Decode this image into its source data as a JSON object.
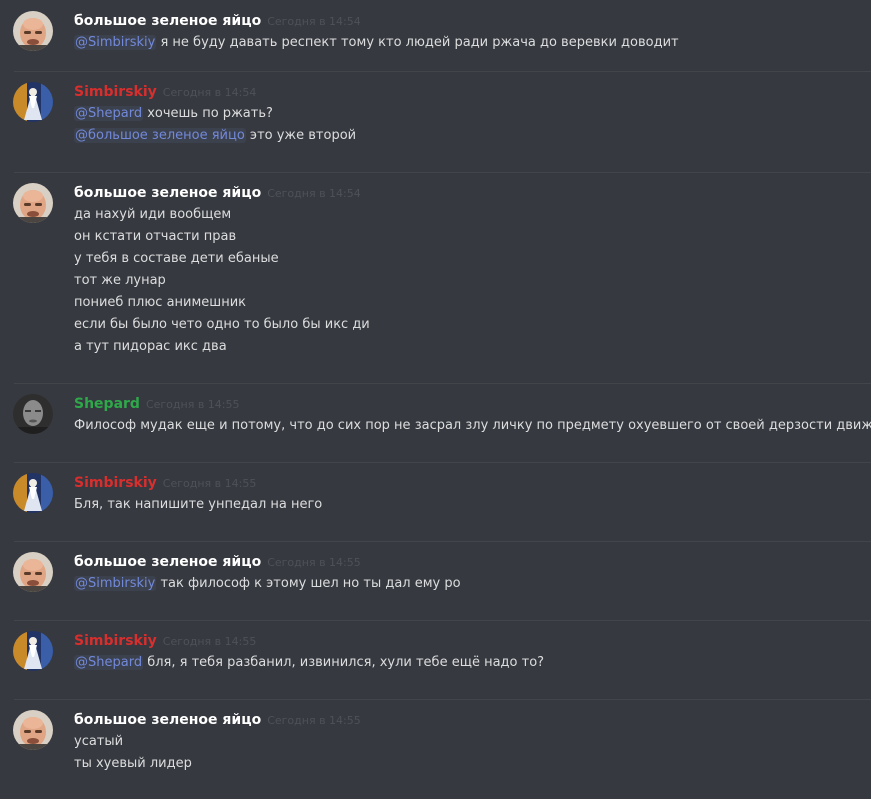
{
  "colors": {
    "background": "#36393f",
    "divider": "#42454a",
    "text": "#dcddde",
    "timestamp": "#4e5258",
    "mention_text": "#7289da",
    "mention_bg": "rgba(114,137,218,0.1)"
  },
  "users": {
    "egg": {
      "name": "большое зеленое яйцо",
      "color": "#ffffff",
      "avatar_icon": "bald-man-avatar-icon"
    },
    "simbirskiy": {
      "name": "Simbirskiy",
      "color": "#d72e2e",
      "avatar_icon": "robed-figure-avatar-icon"
    },
    "shepard": {
      "name": "Shepard",
      "color": "#2fa84a",
      "avatar_icon": "grayscale-portrait-avatar-icon"
    }
  },
  "messages": [
    {
      "author": "egg",
      "timestamp": "Сегодня в 14:54",
      "lines": [
        [
          {
            "text": "@Simbirskiy",
            "mention": true
          },
          {
            "text": " я не буду давать респект тому кто людей ради ржача до веревки доводит"
          }
        ]
      ]
    },
    {
      "author": "simbirskiy",
      "timestamp": "Сегодня в 14:54",
      "lines": [
        [
          {
            "text": "@Shepard",
            "mention": true
          },
          {
            "text": " хочешь по ржать?"
          }
        ],
        [
          {
            "text": "@большое зеленое яйцо",
            "mention": true
          },
          {
            "text": " это уже второй"
          }
        ]
      ]
    },
    {
      "author": "egg",
      "timestamp": "Сегодня в 14:54",
      "lines": [
        [
          {
            "text": "да нахуй иди вообщем"
          }
        ],
        [
          {
            "text": "он кстати отчасти прав"
          }
        ],
        [
          {
            "text": "у тебя в составе дети ебаные"
          }
        ],
        [
          {
            "text": "тот же лунар"
          }
        ],
        [
          {
            "text": "пониеб плюс анимешник"
          }
        ],
        [
          {
            "text": "если бы было чето одно то было бы икс ди"
          }
        ],
        [
          {
            "text": "а тут пидорас икс два"
          }
        ]
      ]
    },
    {
      "author": "shepard",
      "timestamp": "Сегодня в 14:55",
      "lines": [
        [
          {
            "text": "Философ мудак еще и потому, что до сих пор не засрал злу личку по предмету охуевшего от своей дерзости движи."
          }
        ]
      ]
    },
    {
      "author": "simbirskiy",
      "timestamp": "Сегодня в 14:55",
      "lines": [
        [
          {
            "text": "Бля, так напишите унпедал на него"
          }
        ]
      ]
    },
    {
      "author": "egg",
      "timestamp": "Сегодня в 14:55",
      "lines": [
        [
          {
            "text": "@Simbirskiy",
            "mention": true
          },
          {
            "text": " так философ к этому шел но ты дал ему ро"
          }
        ]
      ]
    },
    {
      "author": "simbirskiy",
      "timestamp": "Сегодня в 14:55",
      "lines": [
        [
          {
            "text": "@Shepard",
            "mention": true
          },
          {
            "text": " бля, я тебя разбанил, извинился, хули тебе ещё надо то?"
          }
        ]
      ]
    },
    {
      "author": "egg",
      "timestamp": "Сегодня в 14:55",
      "lines": [
        [
          {
            "text": "усатый"
          }
        ],
        [
          {
            "text": "ты хуевый лидер"
          }
        ]
      ]
    }
  ]
}
